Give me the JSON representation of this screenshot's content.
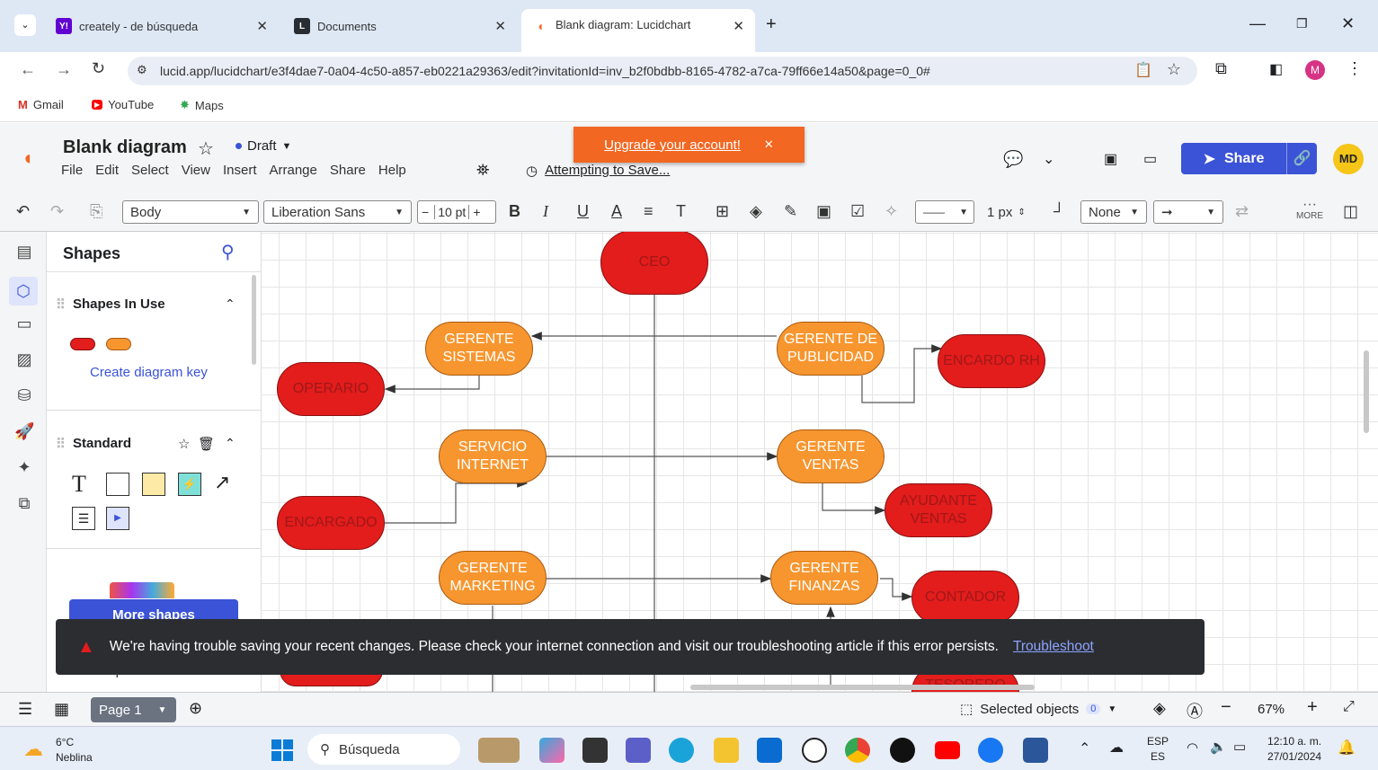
{
  "browser": {
    "tabs": [
      {
        "label": "creately - de búsqueda",
        "favicon": "Y!"
      },
      {
        "label": "Documents",
        "favicon": "L"
      },
      {
        "label": "Blank diagram: Lucidchart",
        "favicon": "L"
      }
    ],
    "url": "lucid.app/lucidchart/e3f4dae7-0a04-4c50-a857-eb0221a29363/edit?invitationId=inv_b2f0bdbb-8165-4782-a7ca-79ff66e14a50&page=0_0#",
    "profile_initial": "M",
    "bookmarks": [
      "Gmail",
      "YouTube",
      "Maps"
    ]
  },
  "app": {
    "title": "Blank diagram",
    "status": "Draft",
    "menu": [
      "File",
      "Edit",
      "Select",
      "View",
      "Insert",
      "Arrange",
      "Share",
      "Help"
    ],
    "saving_text": "Attempting to Save...",
    "upgrade_text": "Upgrade your account!",
    "share_label": "Share",
    "user_initials": "MD",
    "accent": "#3b53d6"
  },
  "toolbar": {
    "style": "Body",
    "font": "Liberation Sans",
    "font_size": "10 pt",
    "line_width": "1 px",
    "arrow_start": "None",
    "more_label": "MORE"
  },
  "shapes_panel": {
    "title": "Shapes",
    "in_use_title": "Shapes In Use",
    "diagram_key": "Create diagram key",
    "standard_title": "Standard",
    "more_shapes": "More shapes",
    "import_data": "Import Data"
  },
  "diagram": {
    "nodes": [
      {
        "text": "CEO",
        "color": "red"
      },
      {
        "text": "GERENTE SISTEMAS",
        "color": "orange"
      },
      {
        "text": "GERENTE DE PUBLICIDAD",
        "color": "orange"
      },
      {
        "text": "ENCARDO RH",
        "color": "red"
      },
      {
        "text": "OPERARIO",
        "color": "red"
      },
      {
        "text": "SERVICIO INTERNET",
        "color": "orange"
      },
      {
        "text": "GERENTE VENTAS",
        "color": "orange"
      },
      {
        "text": "AYUDANTE VENTAS",
        "color": "red"
      },
      {
        "text": "ENCARGADO",
        "color": "red"
      },
      {
        "text": "GERENTE MARKETING",
        "color": "orange"
      },
      {
        "text": "GERENTE FINANZAS",
        "color": "orange"
      },
      {
        "text": "CONTADOR",
        "color": "red"
      },
      {
        "text": "TESORERO",
        "color": "red"
      }
    ]
  },
  "error_banner": {
    "message": "We're having trouble saving your recent changes. Please check your internet connection and visit our troubleshooting article if this error persists.",
    "link": "Troubleshoot"
  },
  "footer": {
    "page_label": "Page 1",
    "selected_label": "Selected objects",
    "selected_count": "0",
    "zoom": "67%"
  },
  "taskbar": {
    "weather_temp": "6°C",
    "weather_desc": "Neblina",
    "search_placeholder": "Búsqueda",
    "lang_top": "ESP",
    "lang_bottom": "ES",
    "time": "12:10 a. m.",
    "date": "27/01/2024"
  }
}
